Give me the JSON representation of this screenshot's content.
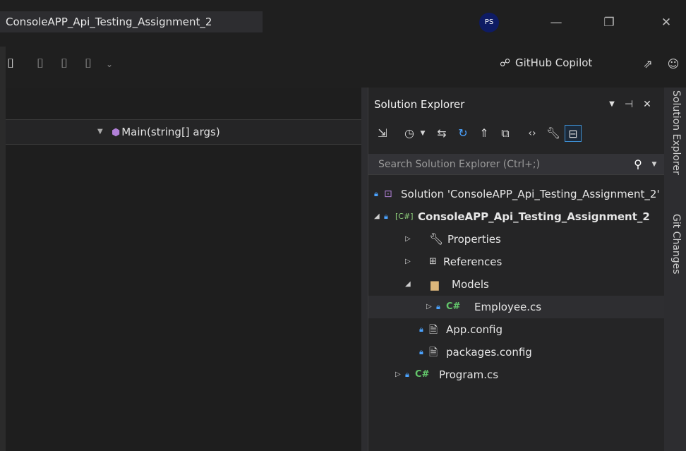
{
  "window": {
    "title": "ConsoleAPP_Api_Testing_Assignment_2",
    "avatar_initials": "PS",
    "minimize_glyph": "—",
    "restore_glyph": "❐",
    "close_glyph": "✕"
  },
  "toolbar": {
    "bookmark_icons": [
      "bookmark-icon",
      "prev-bookmark-icon",
      "next-bookmark-icon",
      "clear-bookmarks-icon",
      "overflow-icon"
    ],
    "copilot_label": "GitHub Copilot",
    "share_icon": "share-icon",
    "feedback_icon": "feedback-icon"
  },
  "editor": {
    "member_dropdown": "Main(string[] args)"
  },
  "solution_explorer": {
    "title": "Solution Explorer",
    "search_placeholder": "Search Solution Explorer (Ctrl+;)",
    "tree": {
      "solution": "Solution 'ConsoleAPP_Api_Testing_Assignment_2'",
      "project": "ConsoleAPP_Api_Testing_Assignment_2",
      "properties": "Properties",
      "references": "References",
      "models": "Models",
      "employee": "Employee.cs",
      "app_config": "App.config",
      "packages_config": "packages.config",
      "program": "Program.cs"
    }
  },
  "side_tabs": {
    "solution_explorer": "Solution Explorer",
    "git_changes": "Git Changes"
  },
  "colors": {
    "background": "#1f1f1f",
    "panel": "#252526",
    "accent_blue": "#4ba3ff",
    "csharp_green": "#63c66b",
    "folder_yellow": "#dcb67a"
  }
}
